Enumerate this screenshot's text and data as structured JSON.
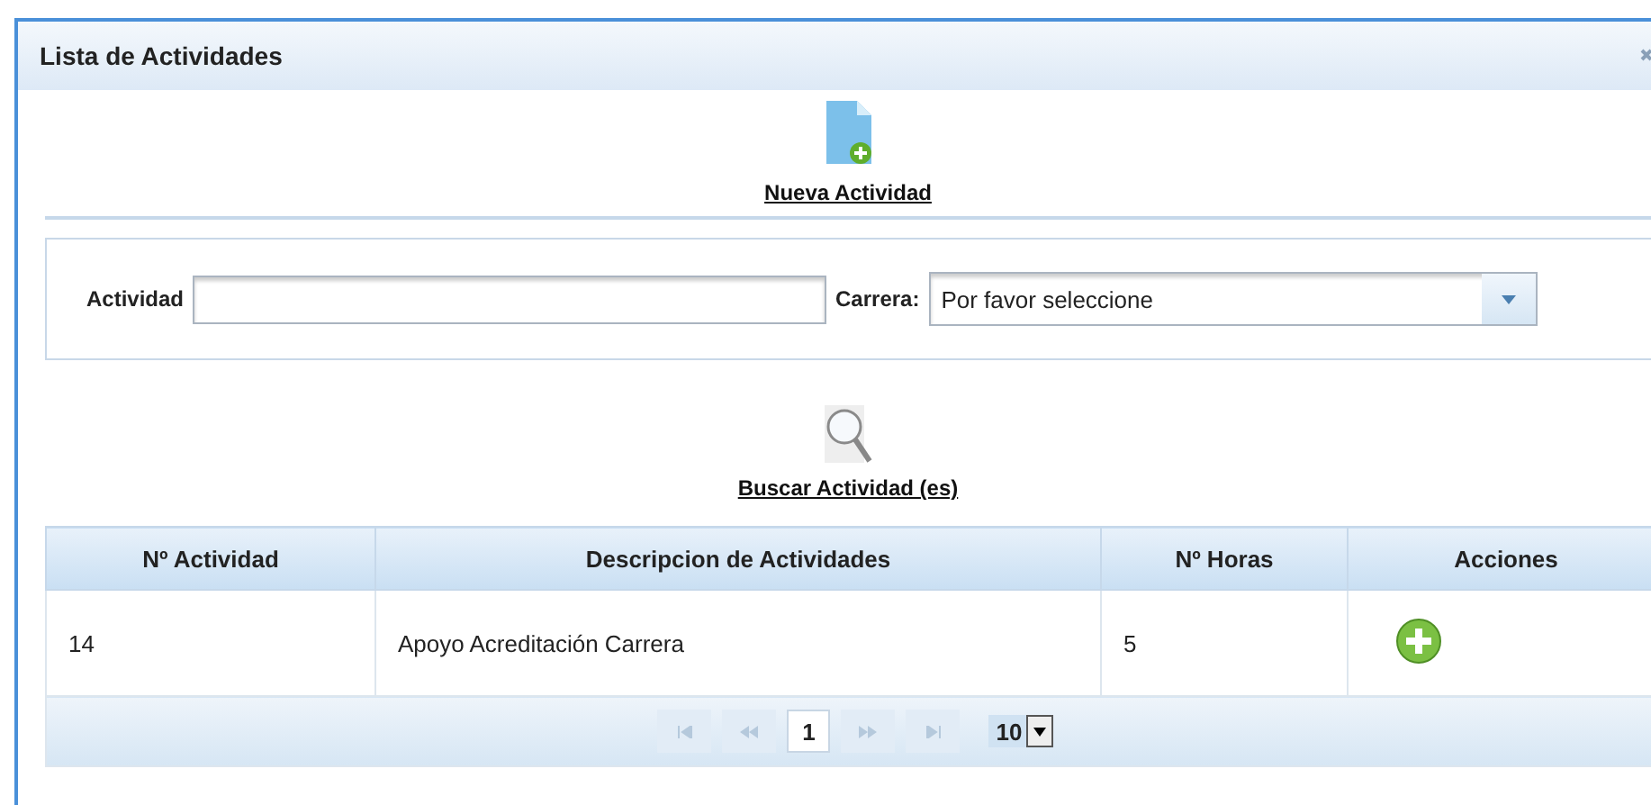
{
  "dialog": {
    "title": "Lista de Actividades"
  },
  "new_link": "Nueva Actividad",
  "filters": {
    "activity_label": "Actividad",
    "career_label": "Carrera:",
    "career_value": "Por favor seleccione"
  },
  "search_link": "Buscar Actividad (es)",
  "table": {
    "columns": [
      "Nº Actividad",
      "Descripcion de Actividades",
      "Nº Horas",
      "Acciones"
    ],
    "rows": [
      {
        "cells": [
          "14",
          "Apoyo Acreditación Carrera",
          "5"
        ]
      }
    ]
  },
  "paginator": {
    "first_disabled": true,
    "prev_disabled": true,
    "pages": [
      {
        "label": "1",
        "selected": true
      }
    ],
    "next_disabled": true,
    "last_disabled": true,
    "rows_per_page": "10"
  }
}
